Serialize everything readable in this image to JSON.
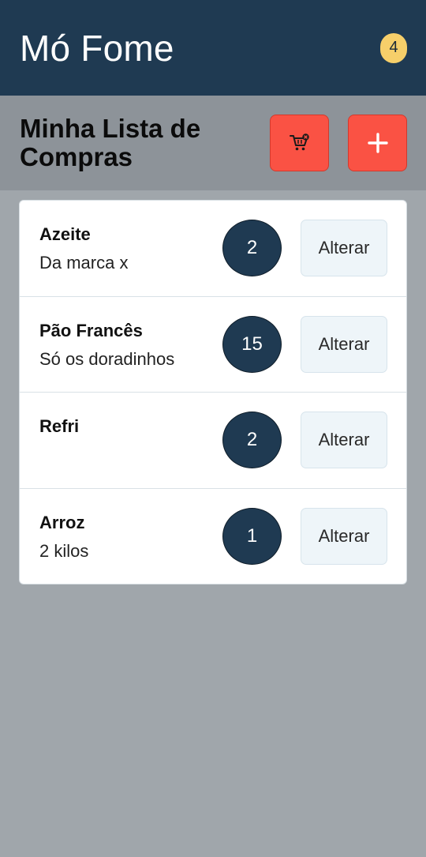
{
  "app": {
    "title": "Mó Fome",
    "badge_count": "4"
  },
  "header": {
    "title": "Minha Lista de Compras",
    "cart_icon": "cart-remove-icon",
    "add_icon": "plus-icon"
  },
  "items": [
    {
      "name": "Azeite",
      "description": "Da marca x",
      "quantity": "2",
      "action_label": "Alterar"
    },
    {
      "name": "Pão Francês",
      "description": "Só os doradinhos",
      "quantity": "15",
      "action_label": "Alterar"
    },
    {
      "name": "Refri",
      "description": "",
      "quantity": "2",
      "action_label": "Alterar"
    },
    {
      "name": "Arroz",
      "description": "2 kilos",
      "quantity": "1",
      "action_label": "Alterar"
    }
  ],
  "colors": {
    "navbar": "#1f3a52",
    "badge": "#f6cf6a",
    "accent_button": "#fa5244",
    "quantity_circle": "#1f3a52",
    "background": "#a0a6ab"
  }
}
